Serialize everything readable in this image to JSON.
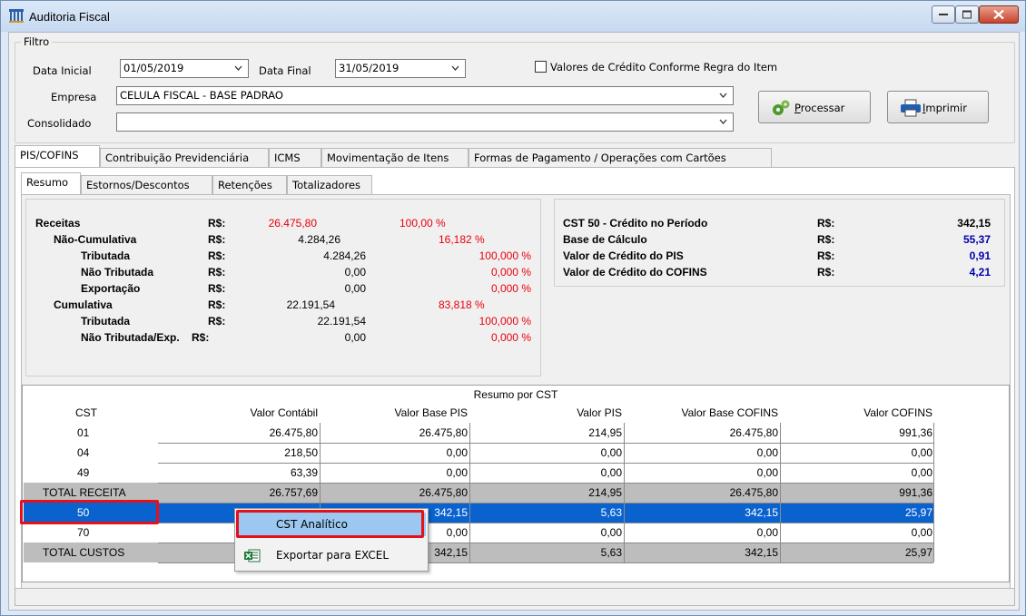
{
  "window": {
    "title": "Auditoria Fiscal"
  },
  "filter": {
    "group_label": "Filtro",
    "data_inicial_label": "Data Inicial",
    "data_inicial_value": "01/05/2019",
    "data_final_label": "Data Final",
    "data_final_value": "31/05/2019",
    "checkbox_label": "Valores de Crédito Conforme Regra do Item",
    "empresa_label": "Empresa",
    "empresa_value": "CELULA FISCAL - BASE PADRAO",
    "consolidado_label": "Consolidado",
    "consolidado_value": "",
    "processar_first": "P",
    "processar_rest": "rocessar",
    "imprimir_first": "I",
    "imprimir_rest": "mprimir"
  },
  "tabs": [
    "PIS/COFINS",
    "Contribuição Previdenciária",
    "ICMS",
    "Movimentação de Itens",
    "Formas de Pagamento / Operações com Cartões"
  ],
  "subtabs": [
    "Resumo",
    "Estornos/Descontos",
    "Retenções",
    "Totalizadores"
  ],
  "resumo": {
    "currency": "R$:",
    "rows": [
      {
        "label": "Receitas",
        "value": "26.475,80",
        "pct": "100,00 %"
      },
      {
        "label": "Não-Cumulativa",
        "value": "4.284,26",
        "pct": "16,182 %"
      },
      {
        "label": "Tributada",
        "value": "4.284,26",
        "pct": "100,000 %"
      },
      {
        "label": "Não Tributada",
        "value": "0,00",
        "pct": "0,000 %"
      },
      {
        "label": "Exportação",
        "value": "0,00",
        "pct": "0,000 %"
      },
      {
        "label": "Cumulativa",
        "value": "22.191,54",
        "pct": "83,818 %"
      },
      {
        "label": "Tributada",
        "value": "22.191,54",
        "pct": "100,000 %"
      },
      {
        "label": "Não Tributada/Exp.",
        "value": "0,00",
        "pct": "0,000 %"
      }
    ]
  },
  "credito": {
    "rows": [
      {
        "label": "CST 50 - Crédito no Período",
        "currency": "R$:",
        "value": "342,15"
      },
      {
        "label": "Base de Cálculo",
        "currency": "R$:",
        "value": "55,37"
      },
      {
        "label": "Valor de Crédito do PIS",
        "currency": "R$:",
        "value": "0,91"
      },
      {
        "label": "Valor de Crédito do COFINS",
        "currency": "R$:",
        "value": "4,21"
      }
    ]
  },
  "grid": {
    "title": "Resumo por CST",
    "columns": [
      "CST",
      "Valor Contábil",
      "Valor Base PIS",
      "Valor PIS",
      "Valor Base COFINS",
      "Valor COFINS"
    ],
    "rows": [
      [
        "01",
        "26.475,80",
        "26.475,80",
        "214,95",
        "26.475,80",
        "991,36"
      ],
      [
        "04",
        "218,50",
        "0,00",
        "0,00",
        "0,00",
        "0,00"
      ],
      [
        "49",
        "63,39",
        "0,00",
        "0,00",
        "0,00",
        "0,00"
      ],
      [
        "TOTAL RECEITA",
        "26.757,69",
        "26.475,80",
        "214,95",
        "26.475,80",
        "991,36"
      ],
      [
        "50",
        "",
        "342,15",
        "5,63",
        "342,15",
        "25,97"
      ],
      [
        "70",
        "",
        "0,00",
        "0,00",
        "0,00",
        "0,00"
      ],
      [
        "TOTAL CUSTOS",
        "",
        "342,15",
        "5,63",
        "342,15",
        "25,97"
      ]
    ]
  },
  "context_menu": {
    "items": [
      "CST Analítico",
      "Exportar para EXCEL"
    ]
  }
}
